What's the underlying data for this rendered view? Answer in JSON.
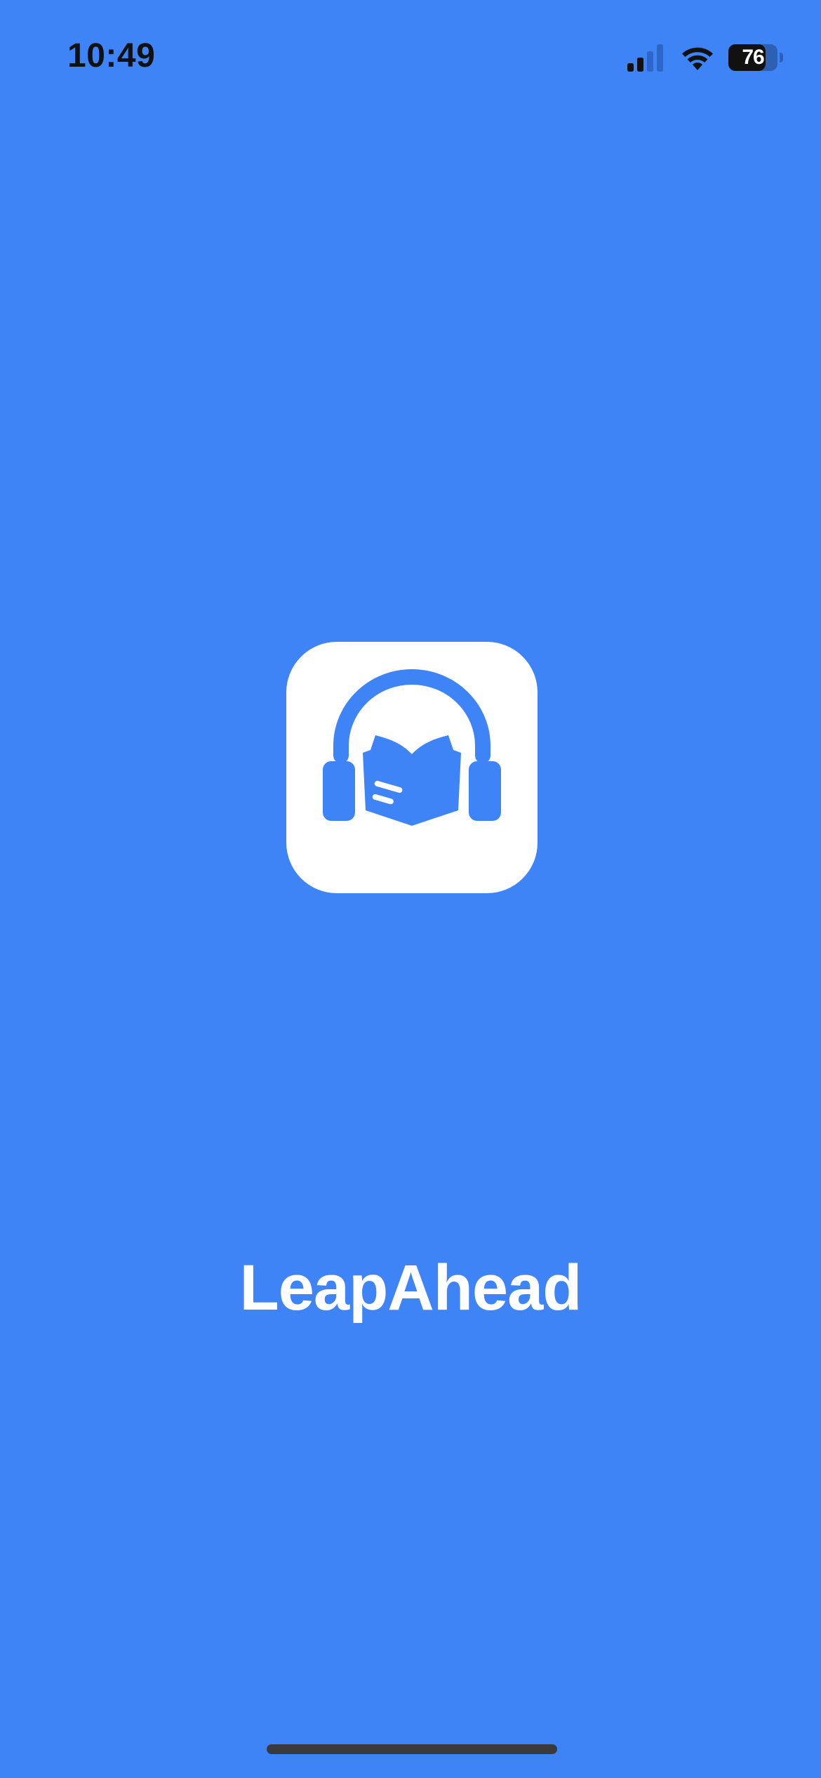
{
  "status_bar": {
    "time": "10:49",
    "battery_level": "76",
    "signal_bars_active": 2,
    "signal_bars_total": 4
  },
  "splash": {
    "app_name": "LeapAhead",
    "logo_icon": "headphones-book-icon"
  },
  "colors": {
    "background": "#3F84F7",
    "logo_tile": "#FFFFFF",
    "text": "#FFFFFF",
    "home_indicator": "#3A3A3C"
  }
}
